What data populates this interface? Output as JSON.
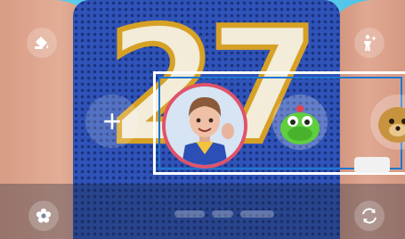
{
  "camera": {
    "top_left_button": {
      "icon": "paint-bucket-icon",
      "label": ""
    },
    "top_right_button": {
      "icon": "person-sparkle-icon",
      "label": ""
    },
    "add_emoji_button": {
      "icon": "plus-icon",
      "label": "+"
    },
    "bottom_left_button": {
      "icon": "flower-icon",
      "label": ""
    },
    "bottom_right_button": {
      "icon": "rotate-camera-icon",
      "label": ""
    }
  },
  "background": {
    "jersey_number": "27"
  },
  "emoji_carousel": {
    "items": [
      {
        "name": "my-emoji-avatar",
        "selected": true
      },
      {
        "name": "green-dino-emoji",
        "selected": false
      },
      {
        "name": "bear-emoji",
        "selected": false
      }
    ]
  },
  "colors": {
    "selection_ring": "#e0536b",
    "selection_frame_outer": "#ffffff",
    "selection_frame_inner": "#1f77d0",
    "sky": "#5fcbec",
    "jersey": "#2f53b8"
  }
}
